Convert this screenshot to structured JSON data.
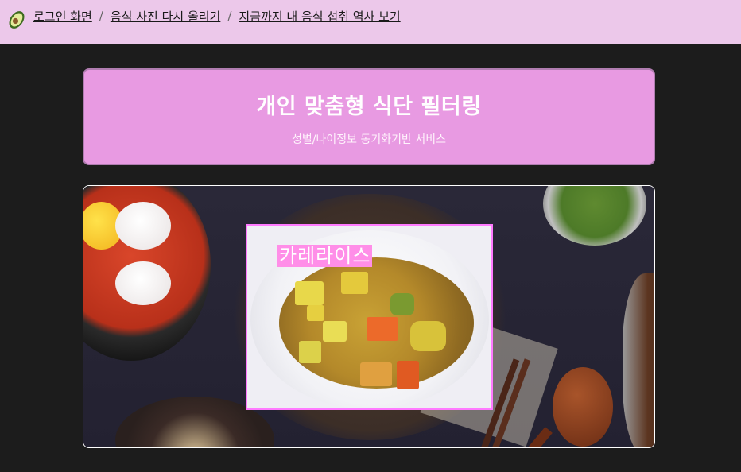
{
  "nav": {
    "logo_icon": "avocado-icon",
    "crumbs": [
      {
        "label": "로그인 화면"
      },
      {
        "label": "음식 사진 다시 올리기"
      },
      {
        "label": "지금까지 내 음식 섭취 역사 보기"
      }
    ],
    "separator": "/"
  },
  "banner": {
    "title": "개인 맞춤형 식단 필터링",
    "subtitle": "성별/나이정보 동기화기반 서비스"
  },
  "photo": {
    "detected_food_label": "카레라이스",
    "frame_color": "#ff7aff",
    "label_bg_color": "#ff8ee8"
  },
  "colors": {
    "nav_bg": "#ecc8ea",
    "banner_bg": "#e89ae2",
    "page_bg": "#1c1c1c"
  }
}
